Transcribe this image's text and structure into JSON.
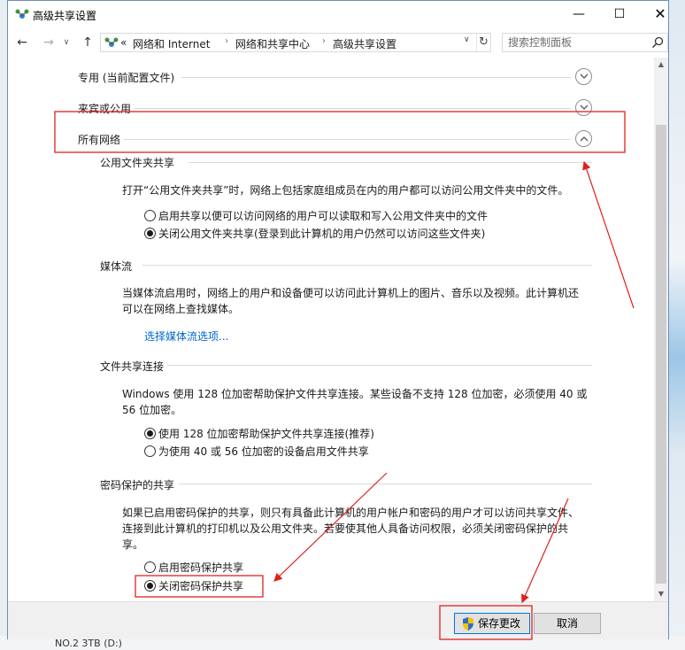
{
  "window": {
    "title": "高级共享设置",
    "controls": {
      "minimize": "—",
      "maximize": "☐",
      "close": "✕"
    }
  },
  "nav": {
    "back": "←",
    "forward": "→",
    "recent": "∨",
    "up": "↑",
    "address": {
      "prefix": "«",
      "crumbs": [
        "网络和 Internet",
        "网络和共享中心",
        "高级共享设置"
      ],
      "separator": "›",
      "dropdown": "∨",
      "refresh": "↻"
    },
    "search": {
      "placeholder": "搜索控制面板"
    }
  },
  "profiles": [
    {
      "label": "专用 (当前配置文件)",
      "expanded": false
    },
    {
      "label": "来宾或公用",
      "expanded": false
    },
    {
      "label": "所有网络",
      "expanded": true
    }
  ],
  "sections": {
    "public_folder": {
      "title": "公用文件夹共享",
      "description": "打开“公用文件夹共享”时，网络上包括家庭组成员在内的用户都可以访问公用文件夹中的文件。",
      "options": [
        {
          "label": "启用共享以便可以访问网络的用户可以读取和写入公用文件夹中的文件",
          "selected": false
        },
        {
          "label": "关闭公用文件夹共享(登录到此计算机的用户仍然可以访问这些文件夹)",
          "selected": true
        }
      ]
    },
    "media": {
      "title": "媒体流",
      "description_line1": "当媒体流启用时，网络上的用户和设备便可以访问此计算机上的图片、音乐以及视频。此计算机还",
      "description_line2": "可以在网络上查找媒体。",
      "link": "选择媒体流选项..."
    },
    "file_sharing": {
      "title": "文件共享连接",
      "description_line1": "Windows 使用 128 位加密帮助保护文件共享连接。某些设备不支持 128 位加密，必须使用 40 或",
      "description_line2": "56 位加密。",
      "options": [
        {
          "label": "使用 128 位加密帮助保护文件共享连接(推荐)",
          "selected": true
        },
        {
          "label": "为使用 40 或 56 位加密的设备启用文件共享",
          "selected": false
        }
      ]
    },
    "password": {
      "title": "密码保护的共享",
      "description_line1": "如果已启用密码保护的共享，则只有具备此计算机的用户帐户和密码的用户才可以访问共享文件、",
      "description_line2": "连接到此计算机的打印机以及公用文件夹。若要使其他人具备访问权限，必须关闭密码保护的共",
      "description_line3": "享。",
      "options": [
        {
          "label": "启用密码保护共享",
          "selected": false
        },
        {
          "label": "关闭密码保护共享",
          "selected": true
        }
      ]
    }
  },
  "footer": {
    "save_label": "保存更改",
    "cancel_label": "取消"
  },
  "scrollbar": {
    "up": "▲",
    "down": "▼"
  },
  "desktop": {
    "taskbar_text": "NO.2 3TB (D:)"
  },
  "colors": {
    "annotation_red": "#e02020",
    "link_blue": "#0066cc",
    "button_focus": "#0078d7"
  }
}
